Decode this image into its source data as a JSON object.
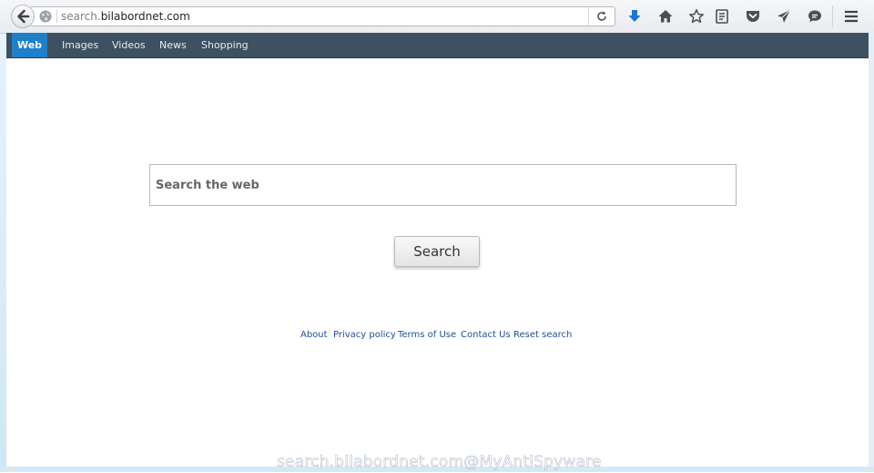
{
  "browser": {
    "url_dim": "search.",
    "url_main": "bilabordnet.com",
    "icons": [
      "back-arrow-icon",
      "globe-icon",
      "reload-icon",
      "download-icon",
      "home-icon",
      "bookmark-star-icon",
      "reading-list-icon",
      "pocket-icon",
      "send-icon",
      "chat-icon",
      "hamburger-menu-icon"
    ]
  },
  "nav": {
    "items": [
      {
        "label": "Web",
        "active": true
      },
      {
        "label": "Images",
        "active": false
      },
      {
        "label": "Videos",
        "active": false
      },
      {
        "label": "News",
        "active": false
      },
      {
        "label": "Shopping",
        "active": false
      }
    ]
  },
  "search": {
    "placeholder": "Search the web",
    "value": "",
    "button_label": "Search"
  },
  "footer": {
    "links": [
      "About",
      "Privacy policy",
      "Terms of Use",
      "Contact Us",
      "Reset search"
    ]
  },
  "watermark": "search.bilabordnet.com@MyAntiSpyware",
  "colors": {
    "navbar_bg": "#3e5162",
    "nav_active_bg": "#1f80c9",
    "link_color": "#1f4f96",
    "download_icon": "#1e74d0"
  }
}
